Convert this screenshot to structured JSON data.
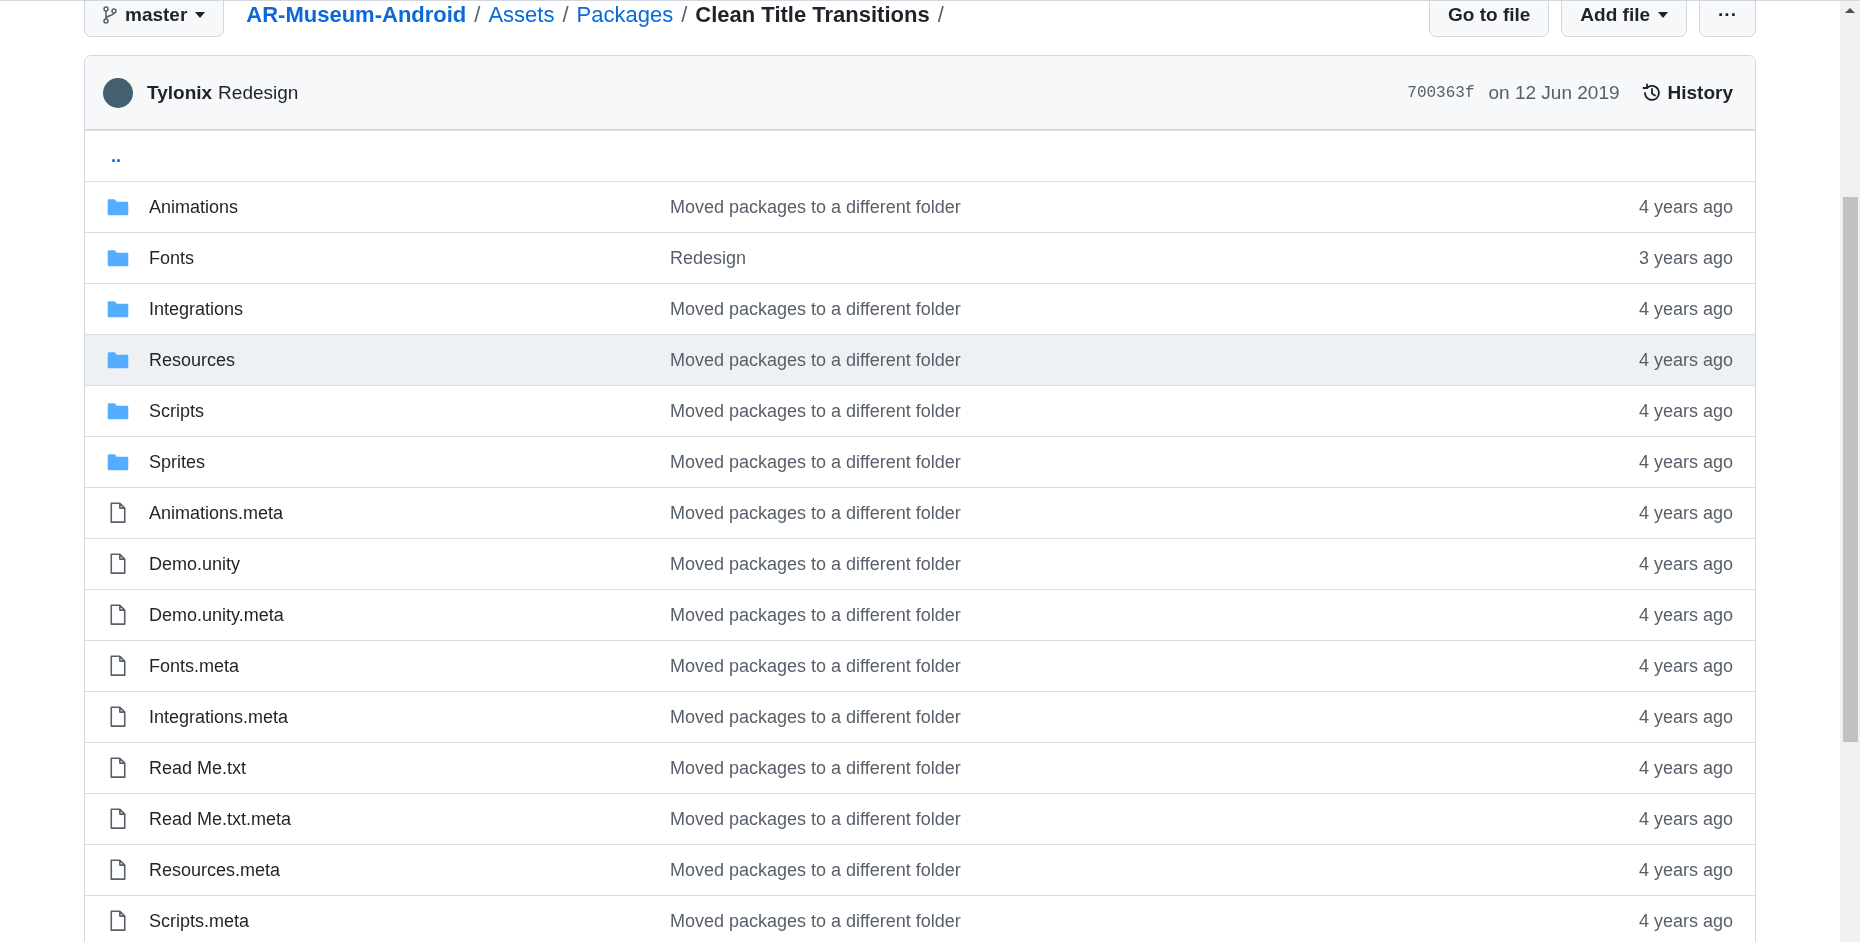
{
  "toolbar": {
    "branch": "master",
    "breadcrumb": [
      {
        "label": "AR-Museum-Android",
        "kind": "repo"
      },
      {
        "label": "Assets",
        "kind": "link"
      },
      {
        "label": "Packages",
        "kind": "link"
      },
      {
        "label": "Clean Title Transitions",
        "kind": "current"
      }
    ],
    "separator": "/",
    "buttons": [
      {
        "label": "Go to file",
        "kind": "plain"
      },
      {
        "label": "Add file",
        "kind": "dropdown"
      },
      {
        "label": "···",
        "kind": "more"
      }
    ]
  },
  "commit": {
    "author": "Tylonix",
    "message": "Redesign",
    "sha": "700363f",
    "date": "on 12 Jun 2019",
    "history": "History"
  },
  "up_link": "..",
  "files": [
    {
      "name": "Animations",
      "kind": "folder",
      "message": "Moved packages to a different folder",
      "age": "4 years ago",
      "highlighted": false
    },
    {
      "name": "Fonts",
      "kind": "folder",
      "message": "Redesign",
      "age": "3 years ago",
      "highlighted": false
    },
    {
      "name": "Integrations",
      "kind": "folder",
      "message": "Moved packages to a different folder",
      "age": "4 years ago",
      "highlighted": false
    },
    {
      "name": "Resources",
      "kind": "folder",
      "message": "Moved packages to a different folder",
      "age": "4 years ago",
      "highlighted": true
    },
    {
      "name": "Scripts",
      "kind": "folder",
      "message": "Moved packages to a different folder",
      "age": "4 years ago",
      "highlighted": false
    },
    {
      "name": "Sprites",
      "kind": "folder",
      "message": "Moved packages to a different folder",
      "age": "4 years ago",
      "highlighted": false
    },
    {
      "name": "Animations.meta",
      "kind": "file",
      "message": "Moved packages to a different folder",
      "age": "4 years ago",
      "highlighted": false
    },
    {
      "name": "Demo.unity",
      "kind": "file",
      "message": "Moved packages to a different folder",
      "age": "4 years ago",
      "highlighted": false
    },
    {
      "name": "Demo.unity.meta",
      "kind": "file",
      "message": "Moved packages to a different folder",
      "age": "4 years ago",
      "highlighted": false
    },
    {
      "name": "Fonts.meta",
      "kind": "file",
      "message": "Moved packages to a different folder",
      "age": "4 years ago",
      "highlighted": false
    },
    {
      "name": "Integrations.meta",
      "kind": "file",
      "message": "Moved packages to a different folder",
      "age": "4 years ago",
      "highlighted": false
    },
    {
      "name": "Read Me.txt",
      "kind": "file",
      "message": "Moved packages to a different folder",
      "age": "4 years ago",
      "highlighted": false
    },
    {
      "name": "Read Me.txt.meta",
      "kind": "file",
      "message": "Moved packages to a different folder",
      "age": "4 years ago",
      "highlighted": false
    },
    {
      "name": "Resources.meta",
      "kind": "file",
      "message": "Moved packages to a different folder",
      "age": "4 years ago",
      "highlighted": false
    },
    {
      "name": "Scripts.meta",
      "kind": "file",
      "message": "Moved packages to a different folder",
      "age": "4 years ago",
      "highlighted": false
    }
  ]
}
